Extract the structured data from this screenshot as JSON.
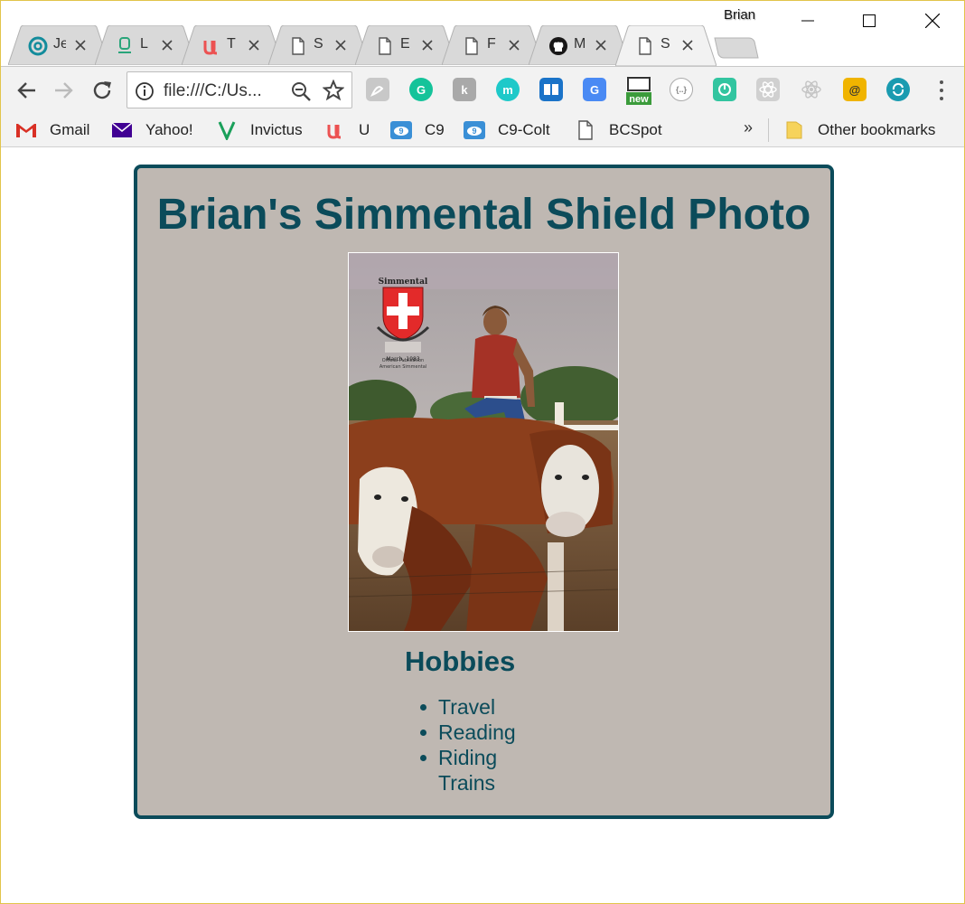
{
  "window": {
    "profile_name": "Brian",
    "controls": [
      "minimize",
      "maximize",
      "close"
    ]
  },
  "tabs": [
    {
      "title": "Je",
      "icon": "at-sign-icon",
      "active": false
    },
    {
      "title": "L",
      "icon": "lamp-icon",
      "active": false
    },
    {
      "title": "T",
      "icon": "udemy-icon",
      "active": false
    },
    {
      "title": "S",
      "icon": "page-icon",
      "active": false
    },
    {
      "title": "E",
      "icon": "page-icon",
      "active": false
    },
    {
      "title": "F",
      "icon": "page-icon",
      "active": false
    },
    {
      "title": "M",
      "icon": "github-icon",
      "active": false
    },
    {
      "title": "S",
      "icon": "page-icon",
      "active": true
    }
  ],
  "toolbar": {
    "url": "file:///C:/Us...",
    "extensions": [
      {
        "name": "pdf-extension-icon",
        "color": "#b7b7b7"
      },
      {
        "name": "grammarly-icon",
        "color": "#15c39a"
      },
      {
        "name": "kami-icon",
        "color": "#a9a9a9"
      },
      {
        "name": "mercury-icon",
        "color": "#1ec9c9"
      },
      {
        "name": "reader-icon",
        "color": "#1a73c8"
      },
      {
        "name": "google-translate-icon",
        "color": "#4a8af4"
      },
      {
        "name": "new-badge-icon",
        "color": "#3b9b3b",
        "badge": "new"
      },
      {
        "name": "json-viewer-icon",
        "color": "#c9c9c9"
      },
      {
        "name": "toggl-icon",
        "color": "#32c5a0"
      },
      {
        "name": "react-devtools-icon",
        "color": "#c9c9c9"
      },
      {
        "name": "react-icon",
        "color": "#d0d0d0"
      },
      {
        "name": "email-lock-icon",
        "color": "#f0b400"
      },
      {
        "name": "sync-icon",
        "color": "#1a9bb0"
      }
    ]
  },
  "bookmarks": {
    "items": [
      {
        "label": "Gmail",
        "icon": "gmail-icon"
      },
      {
        "label": "Yahoo!",
        "icon": "yahoo-mail-icon"
      },
      {
        "label": "Invictus",
        "icon": "invictus-v-icon"
      },
      {
        "label": "U",
        "icon": "udemy-icon"
      },
      {
        "label": "C9",
        "icon": "cloud9-icon"
      },
      {
        "label": "C9-Colt",
        "icon": "cloud9-icon"
      },
      {
        "label": "BCSpot",
        "icon": "page-icon"
      }
    ],
    "overflow": "»",
    "other": "Other bookmarks"
  },
  "page": {
    "title": "Brian's Simmental Shield Photo",
    "photo_caption_lines": [
      "Simmental",
      "March, 1983"
    ],
    "hobbies_heading": "Hobbies",
    "hobbies": [
      "Travel",
      "Reading",
      "Riding",
      "Trains"
    ],
    "accent_color": "#0b4b5a",
    "card_background": "#bfb8b2"
  }
}
